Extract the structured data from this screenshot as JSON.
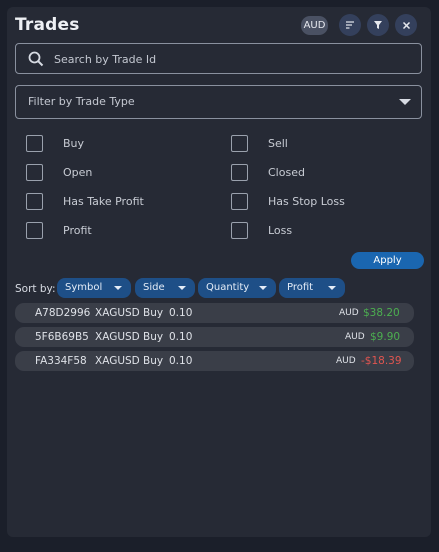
{
  "header": {
    "title": "Trades",
    "currency": "AUD",
    "sort_icon": "sort-lines-icon",
    "filter_icon": "funnel-icon",
    "close_icon": "close-icon"
  },
  "search": {
    "placeholder": "Search by Trade Id",
    "value": ""
  },
  "filter": {
    "label": "Filter by Trade Type"
  },
  "checkboxes": [
    {
      "label": "Buy",
      "checked": false
    },
    {
      "label": "Sell",
      "checked": false
    },
    {
      "label": "Open",
      "checked": false
    },
    {
      "label": "Closed",
      "checked": false
    },
    {
      "label": "Has Take Profit",
      "checked": false
    },
    {
      "label": "Has Stop Loss",
      "checked": false
    },
    {
      "label": "Profit",
      "checked": false
    },
    {
      "label": "Loss",
      "checked": false
    }
  ],
  "apply_label": "Apply",
  "sort": {
    "label": "Sort by:",
    "options": [
      "Symbol",
      "Side",
      "Quantity",
      "Profit"
    ]
  },
  "trades": [
    {
      "id": "A78D2996",
      "symbol": "XAGUSD",
      "side": "Buy",
      "qty": "0.10",
      "currency": "AUD",
      "profit": "$38.20"
    },
    {
      "id": "5F6B69B5",
      "symbol": "XAGUSD",
      "side": "Buy",
      "qty": "0.10",
      "currency": "AUD",
      "profit": "$9.90"
    },
    {
      "id": "FA334F58",
      "symbol": "XAGUSD",
      "side": "Buy",
      "qty": "0.10",
      "currency": "AUD",
      "profit": "-$18.39"
    }
  ],
  "colors": {
    "background": "#1b1f2a",
    "panel": "#262a35",
    "accent": "#1a66b0",
    "profit_positive": "#4caf50",
    "profit_negative": "#e05550"
  }
}
